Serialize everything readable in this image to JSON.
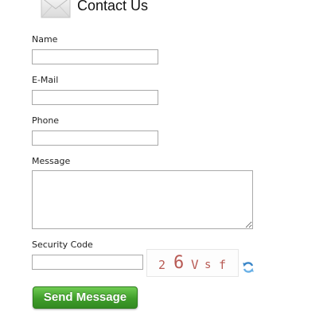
{
  "header": {
    "title": "Contact Us",
    "icon": "envelope-icon"
  },
  "form": {
    "name_label": "Name",
    "name_value": "",
    "email_label": "E-Mail",
    "email_value": "",
    "phone_label": "Phone",
    "phone_value": "",
    "message_label": "Message",
    "message_value": "",
    "security_label": "Security Code",
    "security_value": "",
    "captcha_chars": [
      "2",
      "6",
      "V",
      "s",
      "f"
    ],
    "refresh_icon": "refresh-icon",
    "send_label": "Send Message"
  },
  "colors": {
    "button_green": "#3f9d2a",
    "captcha_text": "#b85a54",
    "field_border": "#a9a9a9"
  }
}
